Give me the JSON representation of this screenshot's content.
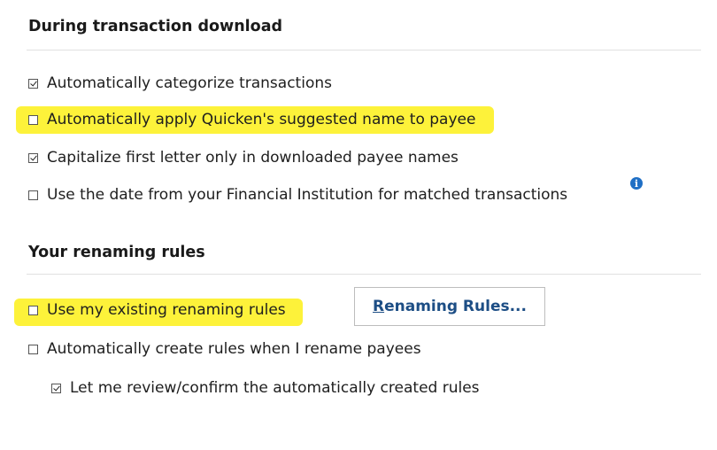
{
  "download_section": {
    "title": "During transaction download",
    "options": [
      {
        "label": "Automatically categorize transactions",
        "checked": true
      },
      {
        "label": "Automatically apply Quicken's suggested name to payee",
        "checked": false
      },
      {
        "label": "Capitalize first letter only in downloaded payee names",
        "checked": true
      },
      {
        "label": "Use the date from your Financial Institution for matched transactions",
        "checked": false
      }
    ],
    "info_icon": "info-icon"
  },
  "renaming_section": {
    "title": "Your renaming rules",
    "options": [
      {
        "label": "Use my existing renaming rules",
        "checked": false
      },
      {
        "label": "Automatically create rules when I rename payees",
        "checked": false
      },
      {
        "label": "Let me review/confirm the automatically created rules",
        "checked": true
      }
    ],
    "button": {
      "mnemonic": "R",
      "rest": "enaming Rules..."
    }
  },
  "colors": {
    "highlight": "#fdf23a",
    "link": "#1d4e85",
    "info": "#1f6fc5"
  }
}
